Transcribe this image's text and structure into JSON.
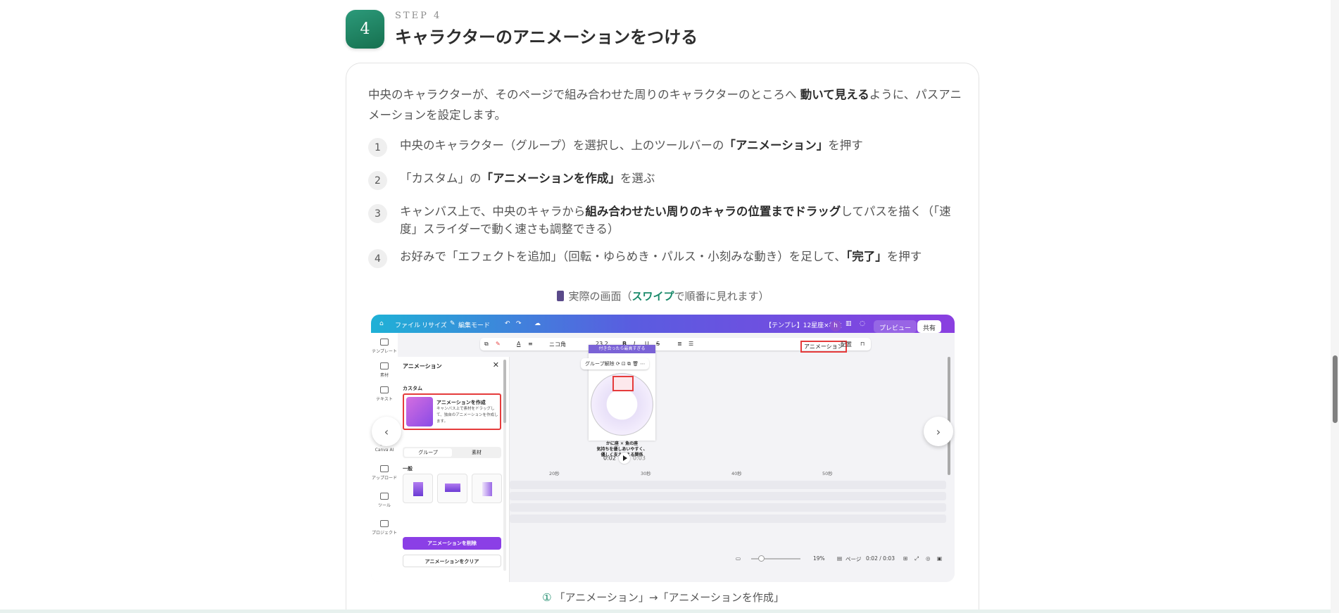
{
  "step": {
    "badge": "4",
    "label": "STEP 4",
    "title": "キャラクターのアニメーションをつける"
  },
  "intro": {
    "part1": "中央のキャラクターが、そのページで組み合わせた周りのキャラクターのところへ",
    "bold": "動いて見える",
    "part2": "ように、パスアニメーションを設定します。"
  },
  "steps": [
    {
      "num": "1",
      "pre": "中央のキャラクター（グループ）を選択し、上のツールバーの",
      "bold": "「アニメーション」",
      "post": "を押す"
    },
    {
      "num": "2",
      "pre": "「カスタム」の",
      "bold": "「アニメーションを作成」",
      "post": "を選ぶ"
    },
    {
      "num": "3",
      "pre": "キャンバス上で、中央のキャラから",
      "bold": "組み合わせたい周りのキャラの位置までドラッグ",
      "post": "してパスを描く（「速度」スライダーで動く速さも調整できる）"
    },
    {
      "num": "4",
      "pre": "お好みで「エフェクトを追加」（回転・ゆらめき・パルス・小刻みな動き）を足して、",
      "bold": "「完了」",
      "post": "を押す"
    }
  ],
  "caption_top": {
    "pre": "実際の画面（",
    "highlight": "スワイプ",
    "post": "で順番に見れます）"
  },
  "screenshot": {
    "topbar": {
      "file": "ファイル",
      "resize": "リサイズ",
      "edit_mode": "編集モード",
      "doc_title": "【テンプレ】12星座×相性",
      "avatar": "h",
      "preview": "プレビュー",
      "share": "共有"
    },
    "sidenav": [
      "テンプレート",
      "素材",
      "テキスト",
      "Canva AI",
      "アップロード",
      "ツール",
      "プロジェクト"
    ],
    "toolbar": {
      "font": "ニコ角",
      "size": "23.2",
      "animation": "アニメーション",
      "position": "配置"
    },
    "panel": {
      "title": "アニメーション",
      "close": "✕",
      "custom": "カスタム",
      "create_title": "アニメーションを作成",
      "create_desc": "キャンバス上で素材をドラッグして、独自のアニメーションを作成します。",
      "seg_group": "グループ",
      "seg_element": "素材",
      "general": "一般",
      "delete": "アニメーションを削除",
      "clear": "アニメーションをクリア"
    },
    "canvas": {
      "banner": "付き合ったら最高すぎる",
      "group_tool": "グループ解除",
      "line1": "かに座 ✕ 魚の座",
      "line2": "気持ちを優しあいやすく、",
      "line3": "優しく支えあえる関係"
    },
    "player": {
      "current": "0:02",
      "total": "0:03"
    },
    "timeline": [
      "20秒",
      "30秒",
      "40秒",
      "50秒"
    ],
    "status": {
      "zoom": "19%",
      "page": "ページ",
      "time": "0:02 / 0:03"
    }
  },
  "nav": {
    "prev": "‹",
    "next": "›"
  },
  "caption_bottom": {
    "num": "①",
    "text": "「アニメーション」→「アニメーションを作成」"
  }
}
